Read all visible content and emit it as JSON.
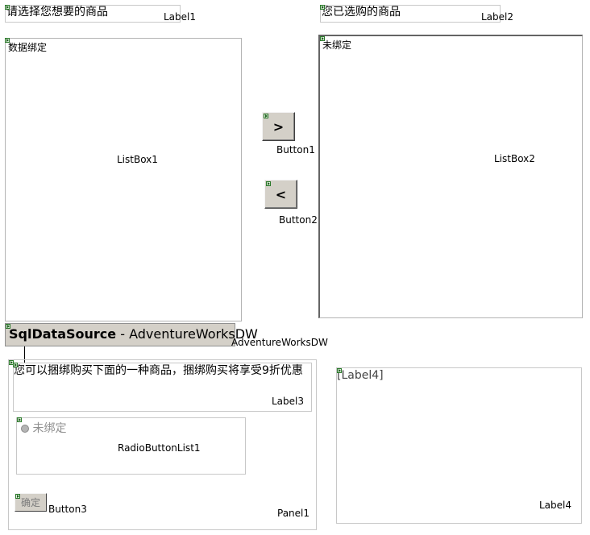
{
  "label1": {
    "text": "请选择您想要的商品",
    "id": "Label1"
  },
  "label2": {
    "text": "您已选购的商品",
    "id": "Label2"
  },
  "listbox1": {
    "text": "数据绑定",
    "id": "ListBox1"
  },
  "listbox2": {
    "text": "未绑定",
    "id": "ListBox2"
  },
  "button1": {
    "text": ">",
    "id": "Button1"
  },
  "button2": {
    "text": "<",
    "id": "Button2"
  },
  "sqldatasource": {
    "type": "SqlDataSource",
    "separator": " - ",
    "name": "AdventureWorksDW",
    "id": "AdventureWorksDW"
  },
  "panel1": {
    "id": "Panel1",
    "label3": {
      "text": "您可以捆绑购买下面的一种商品，捆绑购买将享受9折优惠",
      "id": "Label3"
    },
    "radiolist": {
      "option": "未绑定",
      "id": "RadioButtonList1"
    },
    "button3": {
      "text": "确定",
      "id": "Button3"
    }
  },
  "label4": {
    "text": "[Label4]",
    "id": "Label4"
  }
}
